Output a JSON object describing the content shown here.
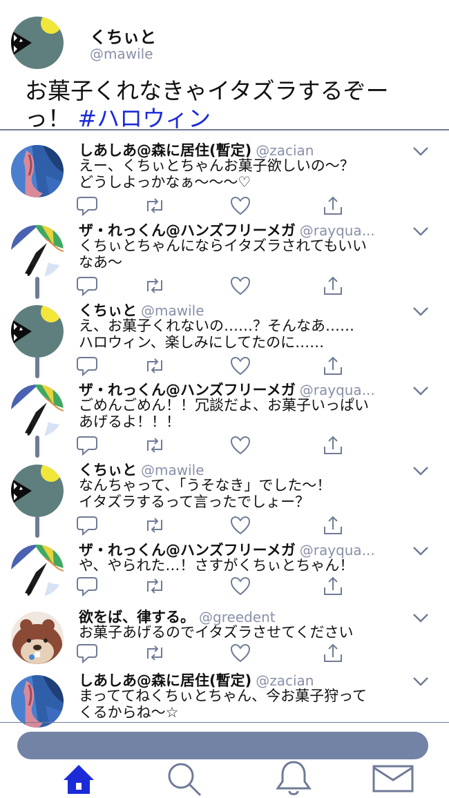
{
  "header": {
    "name": "くちぃと",
    "handle": "@mawile",
    "text": "お菓子くれなきゃイタズラするぞーっ！",
    "hashtag": "#ハロウィン"
  },
  "tweets": [
    {
      "name": "しあしあ@森に居住(暫定)",
      "handle": "@zacian",
      "lines": [
        "えー、くちぃとちゃんお菓子欲しいの～？",
        "どうしよっかなぁ～～～♡"
      ],
      "avatar": "zacian-avatar"
    },
    {
      "name": "ザ・れっくん@ハンズフリーメガ",
      "handle": "@rayqua...",
      "lines": [
        "くちぃとちゃんにならイタズラされてもいい",
        "なあ～"
      ],
      "avatar": "rayquaza-avatar"
    },
    {
      "name": "くちぃと",
      "handle": "@mawile",
      "lines": [
        "え、お菓子くれないの……？そんなあ……",
        "ハロウィン、楽しみにしてたのに……"
      ],
      "avatar": "mawile-avatar"
    },
    {
      "name": "ザ・れっくん@ハンズフリーメガ",
      "handle": "@rayqua...",
      "lines": [
        "ごめんごめん！！冗談だよ、お菓子いっぱい",
        "あげるよ！！！"
      ],
      "avatar": "rayquaza-avatar"
    },
    {
      "name": "くちぃと",
      "handle": "@mawile",
      "lines": [
        "なんちゃって、「うそなき」でした～！",
        "イタズラするって言ったでしょー？"
      ],
      "avatar": "mawile-avatar"
    },
    {
      "name": "ザ・れっくん@ハンズフリーメガ",
      "handle": "@rayqua...",
      "lines": [
        "や、やられた…！さすがくちぃとちゃん！",
        ""
      ],
      "avatar": "rayquaza-avatar"
    },
    {
      "name": "欲をば、律する。",
      "handle": "@greedent",
      "lines": [
        "お菓子あげるのでイタズラさせてください",
        ""
      ],
      "avatar": "greedent-avatar"
    },
    {
      "name": "しあしあ@森に居住(暫定)",
      "handle": "@zacian",
      "lines": [
        "まっててねくちぃとちゃん、今お菓子狩って",
        "くるからね～☆"
      ],
      "avatar": "zacian-avatar"
    }
  ],
  "nav": [
    "home-icon",
    "search-icon",
    "notifications-bell-icon",
    "messages-envelope-icon"
  ],
  "colors": {
    "accent": "#6f7a96",
    "hashtag": "#1c2bd8",
    "handle": "#8a8fa8",
    "nav_active": "#1c2bd8",
    "compose_bar": "#7383a6"
  }
}
